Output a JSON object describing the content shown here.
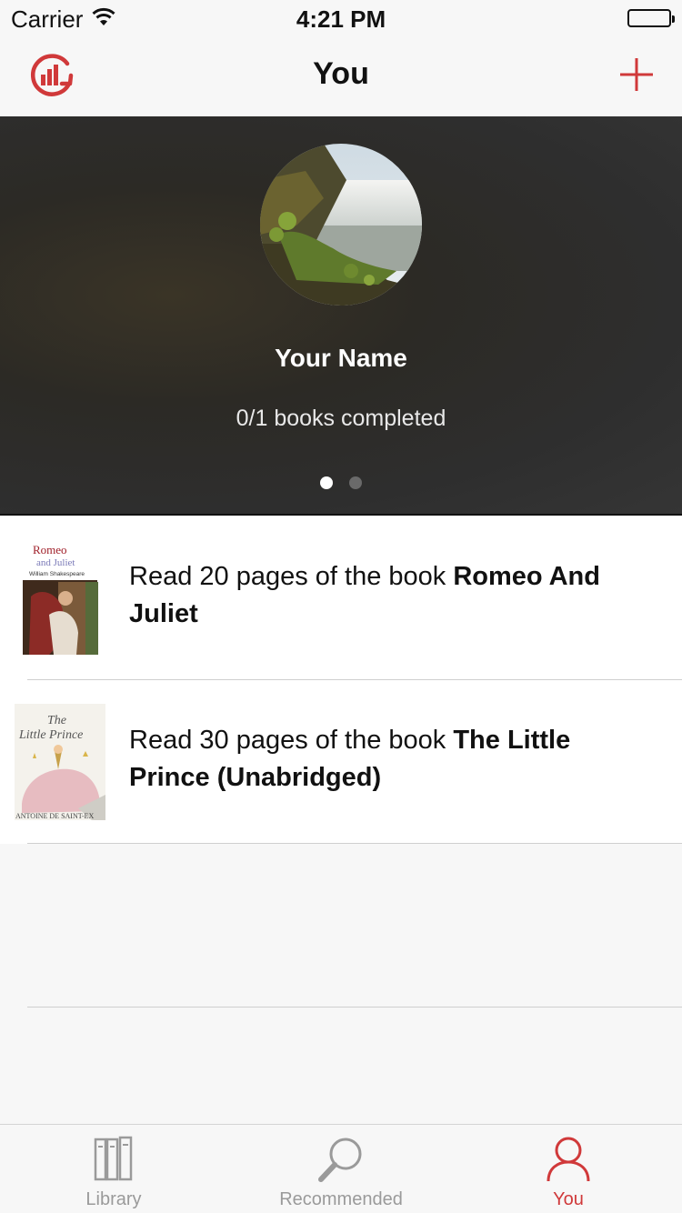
{
  "status_bar": {
    "carrier": "Carrier",
    "time": "4:21 PM"
  },
  "nav": {
    "title": "You"
  },
  "profile": {
    "name": "Your Name",
    "progress": "0/1 books completed",
    "page_indicator": {
      "count": 2,
      "current": 1
    }
  },
  "goals": [
    {
      "prefix": "Read 20 pages of the book ",
      "book_title": "Romeo And Juliet",
      "cover": {
        "title_line1": "Romeo",
        "title_line2": "and Juliet",
        "author": "William Shakespeare"
      }
    },
    {
      "prefix": "Read 30 pages of the book ",
      "book_title": "The Little Prince (Unabridged)",
      "cover": {
        "title_line1": "The",
        "title_line2": "Little Prince",
        "author": "ANTOINE DE SAINT-EX"
      }
    }
  ],
  "tabs": [
    {
      "label": "Library",
      "icon": "books-icon",
      "active": false
    },
    {
      "label": "Recommended",
      "icon": "magnifier-icon",
      "active": false
    },
    {
      "label": "You",
      "icon": "person-icon",
      "active": true
    }
  ],
  "colors": {
    "accent": "#d0393a",
    "inactive": "#9a9a9a"
  }
}
